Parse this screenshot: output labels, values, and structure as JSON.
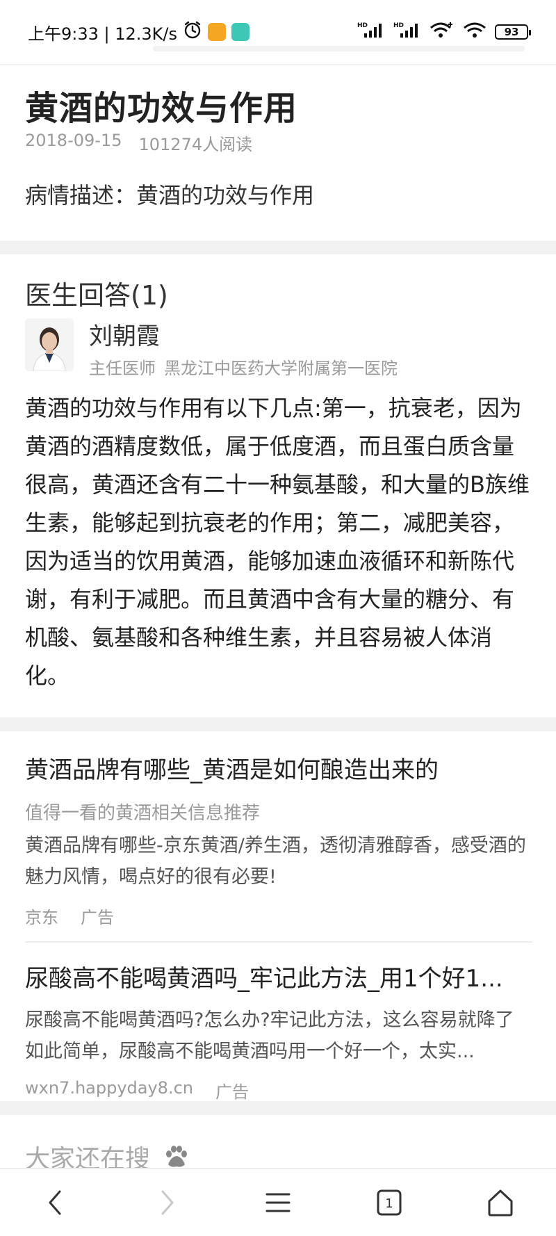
{
  "status_bar": {
    "time_speed": "上午9:33 | 12.3K/s",
    "battery": "93"
  },
  "article": {
    "title": "黄酒的功效与作用",
    "date": "2018-09-15",
    "reads": "101274人阅读",
    "condition_label": "病情描述：",
    "condition_text": "黄酒的功效与作用"
  },
  "answers": {
    "heading": "医生回答(1)",
    "doctor_name": "刘朝霞",
    "doctor_title": "主任医师",
    "doctor_hospital": "黑龙江中医药大学附属第一医院",
    "body": "黄酒的功效与作用有以下几点:第一，抗衰老，因为黄酒的酒精度数低，属于低度酒，而且蛋白质含量很高，黄酒还含有二十一种氨基酸，和大量的B族维生素，能够起到抗衰老的作用；第二，减肥美容，因为适当的饮用黄酒，能够加速血液循环和新陈代谢，有利于减肥。而且黄酒中含有大量的糖分、有机酸、氨基酸和各种维生素，并且容易被人体消化。"
  },
  "ads": [
    {
      "title": "黄酒品牌有哪些_黄酒是如何酿造出来的",
      "subtitle": "值得一看的黄酒相关信息推荐",
      "desc": "黄酒品牌有哪些-京东黄酒/养生酒，透彻清雅醇香，感受酒的魅力风情，喝点好的很有必要!",
      "source": "京东",
      "tag": "广告"
    },
    {
      "title": "尿酸高不能喝黄酒吗_牢记此方法_用1个好1...",
      "desc": "尿酸高不能喝黄酒吗?怎么办?牢记此方法，这么容易就降了如此简单，尿酸高不能喝黄酒吗用一个好一个，太实...",
      "source": "wxn7.happyday8.cn",
      "tag": "广告"
    }
  ],
  "also_search": {
    "label": "大家还在搜"
  },
  "bottom_nav": {
    "tab_count": "1"
  },
  "colors": {
    "accent_orange": "#f5a623",
    "accent_teal": "#3cc8b4",
    "gray_text": "#9a9a9a",
    "separator": "#f2f2f2"
  }
}
